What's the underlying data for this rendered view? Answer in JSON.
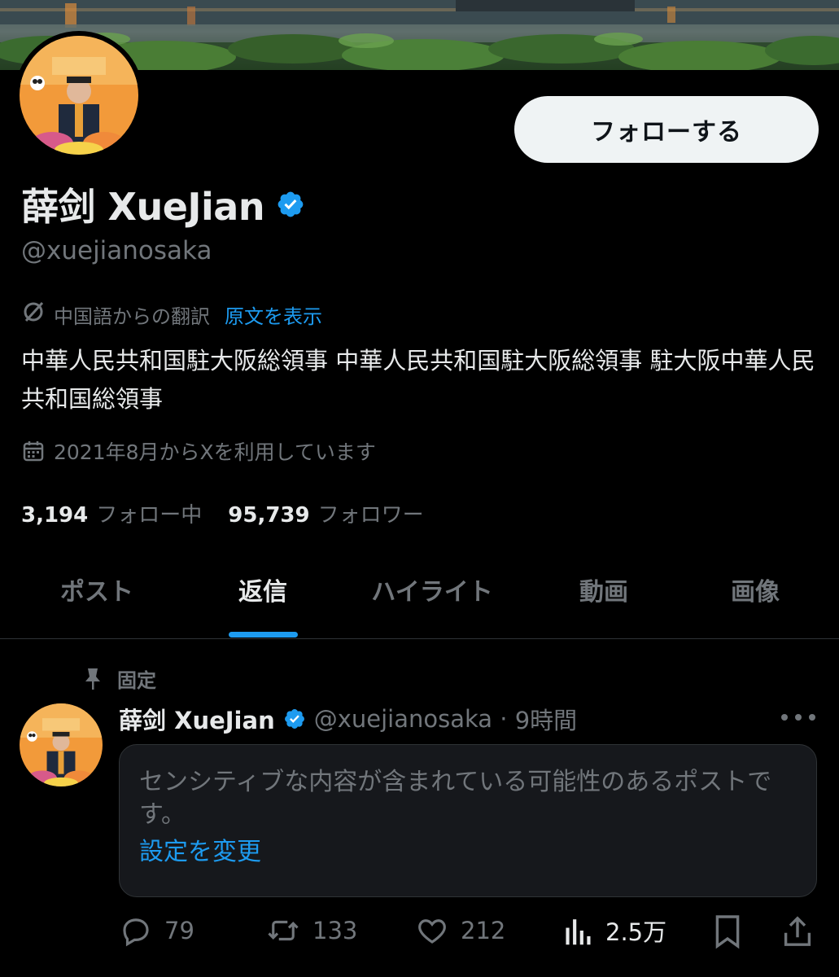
{
  "header": {
    "follow_label": "フォローする"
  },
  "profile": {
    "display_name": "薛剑 XueJian",
    "handle": "@xuejianosaka",
    "translation_note": "中国語からの翻訳",
    "show_original": "原文を表示",
    "bio": "中華人民共和国駐大阪総領事 中華人民共和国駐大阪総領事 駐大阪中華人民共和国総領事",
    "joined": "2021年8月からXを利用しています",
    "following_count": "3,194",
    "following_label": "フォロー中",
    "followers_count": "95,739",
    "followers_label": "フォロワー"
  },
  "tabs": [
    {
      "label": "ポスト",
      "active": false
    },
    {
      "label": "返信",
      "active": true
    },
    {
      "label": "ハイライト",
      "active": false
    },
    {
      "label": "動画",
      "active": false
    },
    {
      "label": "画像",
      "active": false
    }
  ],
  "post": {
    "pinned_label": "固定",
    "author_name": "薛剑 XueJian",
    "author_handle": "@xuejianosaka",
    "separator": " · ",
    "time": "9時間",
    "sensitive_text": "センシティブな内容が含まれている可能性のあるポストです。",
    "settings_link": "設定を変更",
    "replies": "79",
    "reposts": "133",
    "likes": "212",
    "views": "2.5万"
  },
  "colors": {
    "background": "#000000",
    "accent": "#1d9bf0",
    "muted_text": "#71767b",
    "primary_text": "#e7e9ea"
  }
}
